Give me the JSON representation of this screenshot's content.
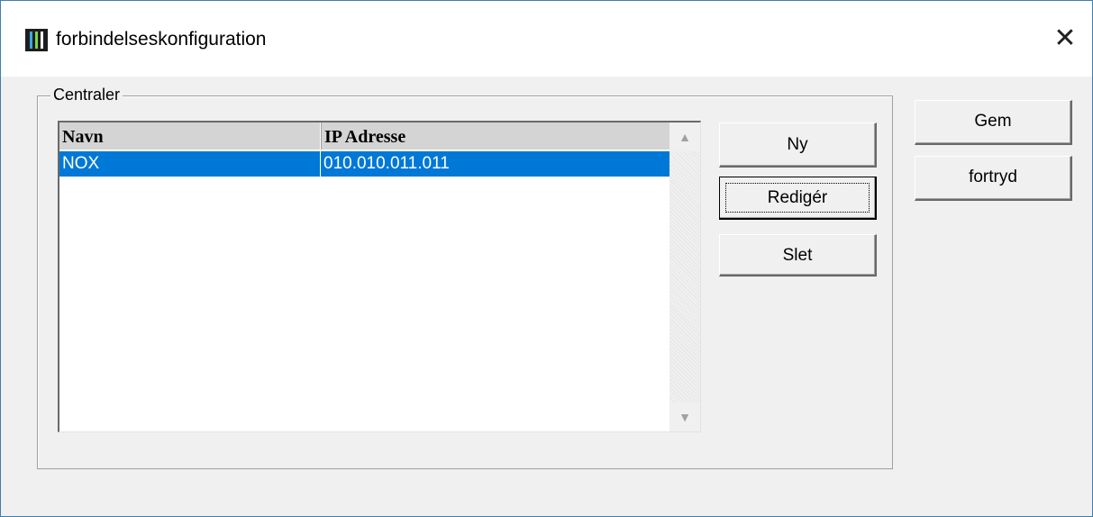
{
  "window": {
    "title": "forbindelseskonfiguration",
    "close_glyph": "✕",
    "icon": "app-logo-icon"
  },
  "group": {
    "label": "Centraler"
  },
  "table": {
    "columns": [
      "Navn",
      "IP Adresse"
    ],
    "rows": [
      {
        "navn": "NOX",
        "ip": "010.010.011.011",
        "selected": true
      }
    ]
  },
  "scrollbar": {
    "up_glyph": "▲",
    "down_glyph": "▼"
  },
  "buttons": {
    "new_label": "Ny",
    "edit_label": "Redigér",
    "delete_label": "Slet",
    "save_label": "Gem",
    "cancel_label": "fortryd"
  },
  "colors": {
    "selection": "#0078d7",
    "window_border": "#3c7fb1",
    "dialog_bg": "#f0f0f0"
  }
}
